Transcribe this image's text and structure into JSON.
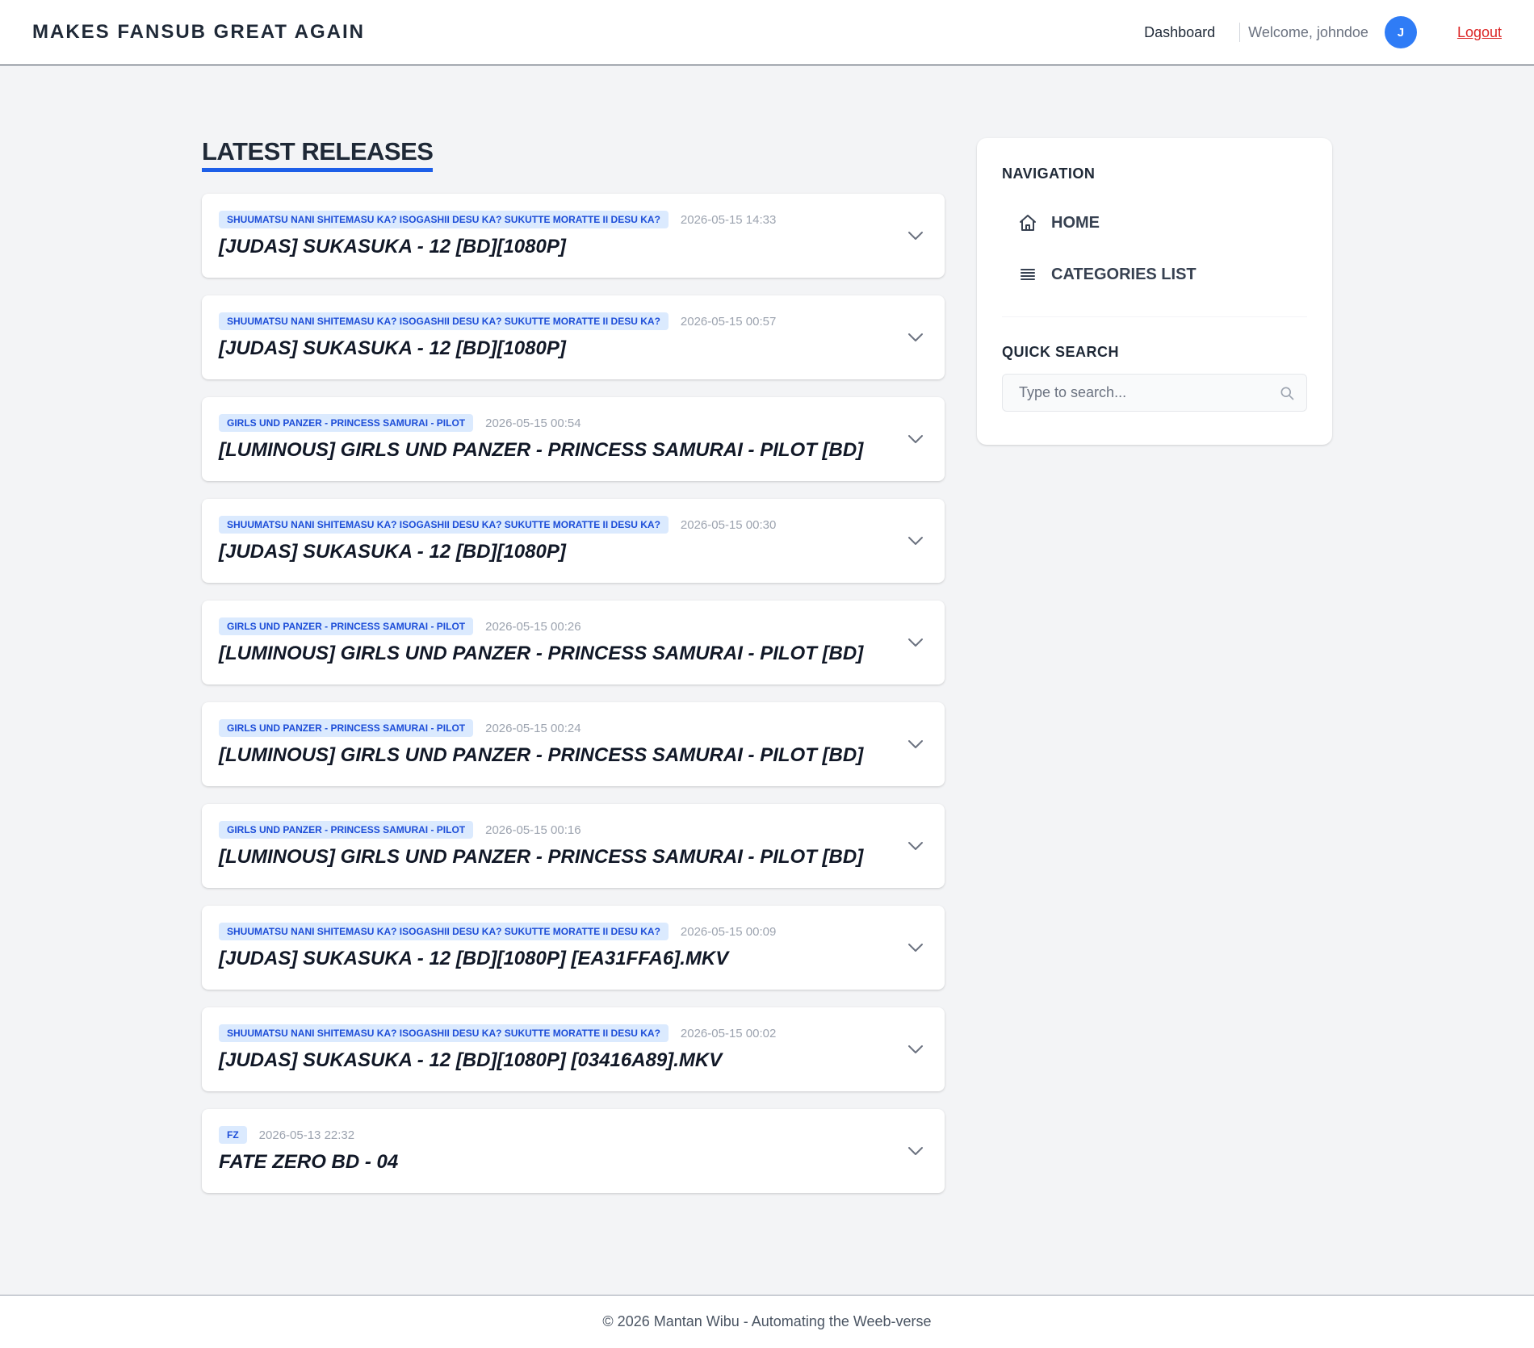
{
  "header": {
    "brand": "MAKES FANSUB GREAT AGAIN",
    "dashboard_label": "Dashboard",
    "welcome_text": "Welcome, johndoe",
    "avatar_initial": "J",
    "logout_label": "Logout"
  },
  "main": {
    "title": "LATEST RELEASES",
    "releases": [
      {
        "tag": "SHUUMATSU NANI SHITEMASU KA? ISOGASHII DESU KA? SUKUTTE MORATTE II DESU KA?",
        "date": "2026-05-15 14:33",
        "title": "[JUDAS] SUKASUKA - 12 [BD][1080P]"
      },
      {
        "tag": "SHUUMATSU NANI SHITEMASU KA? ISOGASHII DESU KA? SUKUTTE MORATTE II DESU KA?",
        "date": "2026-05-15 00:57",
        "title": "[JUDAS] SUKASUKA - 12 [BD][1080P]"
      },
      {
        "tag": "GIRLS UND PANZER - PRINCESS SAMURAI - PILOT",
        "date": "2026-05-15 00:54",
        "title": "[LUMINOUS] GIRLS UND PANZER - PRINCESS SAMURAI - PILOT [BD]"
      },
      {
        "tag": "SHUUMATSU NANI SHITEMASU KA? ISOGASHII DESU KA? SUKUTTE MORATTE II DESU KA?",
        "date": "2026-05-15 00:30",
        "title": "[JUDAS] SUKASUKA - 12 [BD][1080P]"
      },
      {
        "tag": "GIRLS UND PANZER - PRINCESS SAMURAI - PILOT",
        "date": "2026-05-15 00:26",
        "title": "[LUMINOUS] GIRLS UND PANZER - PRINCESS SAMURAI - PILOT [BD]"
      },
      {
        "tag": "GIRLS UND PANZER - PRINCESS SAMURAI - PILOT",
        "date": "2026-05-15 00:24",
        "title": "[LUMINOUS] GIRLS UND PANZER - PRINCESS SAMURAI - PILOT [BD]"
      },
      {
        "tag": "GIRLS UND PANZER - PRINCESS SAMURAI - PILOT",
        "date": "2026-05-15 00:16",
        "title": "[LUMINOUS] GIRLS UND PANZER - PRINCESS SAMURAI - PILOT [BD]"
      },
      {
        "tag": "SHUUMATSU NANI SHITEMASU KA? ISOGASHII DESU KA? SUKUTTE MORATTE II DESU KA?",
        "date": "2026-05-15 00:09",
        "title": "[JUDAS] SUKASUKA - 12 [BD][1080P] [EA31FFA6].MKV"
      },
      {
        "tag": "SHUUMATSU NANI SHITEMASU KA? ISOGASHII DESU KA? SUKUTTE MORATTE II DESU KA?",
        "date": "2026-05-15 00:02",
        "title": "[JUDAS] SUKASUKA - 12 [BD][1080P] [03416A89].MKV"
      },
      {
        "tag": "FZ",
        "date": "2026-05-13 22:32",
        "title": "FATE ZERO BD - 04"
      }
    ]
  },
  "sidebar": {
    "nav_heading": "NAVIGATION",
    "items": [
      {
        "label": "HOME",
        "icon": "home-icon"
      },
      {
        "label": "CATEGORIES LIST",
        "icon": "list-icon"
      }
    ],
    "search_heading": "QUICK SEARCH",
    "search_placeholder": "Type to search..."
  },
  "footer": {
    "text": "© 2026 Mantan Wibu - Automating the Weeb-verse"
  },
  "colors": {
    "accent": "#1d5fe8",
    "avatar": "#2f7cf6",
    "tag_bg": "#dbeafe",
    "tag_text": "#1d4ed8",
    "logout": "#dc2626"
  }
}
